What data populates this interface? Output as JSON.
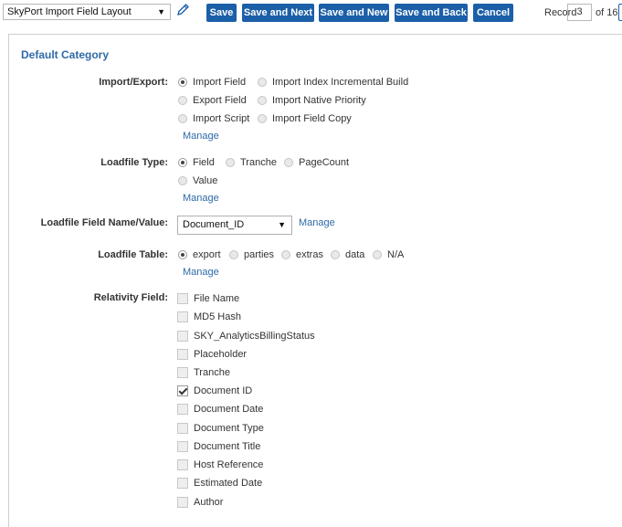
{
  "toolbar": {
    "layout_select": "SkyPort Import Field Layout",
    "buttons": [
      {
        "label": "Save"
      },
      {
        "label": "Save and Next"
      },
      {
        "label": "Save and New"
      },
      {
        "label": "Save and Back"
      },
      {
        "label": "Cancel"
      }
    ],
    "record_label": "Record",
    "record_value": "3",
    "record_of": "of 16"
  },
  "colors": {
    "accent": "#1b5fa8",
    "link": "#2e6aa7"
  },
  "form": {
    "category": "Default Category",
    "import_export": {
      "label": "Import/Export:",
      "options": [
        {
          "label": "Import Field",
          "selected": true
        },
        {
          "label": "Import Index Incremental Build",
          "selected": false
        },
        {
          "label": "Export Field",
          "selected": false
        },
        {
          "label": "Import Native Priority",
          "selected": false
        },
        {
          "label": "Import Script",
          "selected": false
        },
        {
          "label": "Import Field Copy",
          "selected": false
        }
      ],
      "manage": "Manage"
    },
    "loadfile_type": {
      "label": "Loadfile Type:",
      "options": [
        {
          "label": "Field",
          "selected": true
        },
        {
          "label": "Tranche",
          "selected": false
        },
        {
          "label": "PageCount",
          "selected": false
        },
        {
          "label": "Value",
          "selected": false
        }
      ],
      "manage": "Manage"
    },
    "loadfile_name": {
      "label": "Loadfile Field Name/Value:",
      "value": "Document_ID",
      "manage": "Manage"
    },
    "loadfile_table": {
      "label": "Loadfile Table:",
      "options": [
        {
          "label": "export",
          "selected": true
        },
        {
          "label": "parties",
          "selected": false
        },
        {
          "label": "extras",
          "selected": false
        },
        {
          "label": "data",
          "selected": false
        },
        {
          "label": "N/A",
          "selected": false
        }
      ],
      "manage": "Manage"
    },
    "relativity_field": {
      "label": "Relativity Field:",
      "items": [
        {
          "label": "File Name",
          "checked": false
        },
        {
          "label": "MD5 Hash",
          "checked": false
        },
        {
          "label": "SKY_AnalyticsBillingStatus",
          "checked": false
        },
        {
          "label": "Placeholder",
          "checked": false
        },
        {
          "label": "Tranche",
          "checked": false
        },
        {
          "label": "Document ID",
          "checked": true
        },
        {
          "label": "Document Date",
          "checked": false
        },
        {
          "label": "Document Type",
          "checked": false
        },
        {
          "label": "Document Title",
          "checked": false
        },
        {
          "label": "Host Reference",
          "checked": false
        },
        {
          "label": "Estimated Date",
          "checked": false
        },
        {
          "label": "Author",
          "checked": false
        }
      ]
    }
  }
}
